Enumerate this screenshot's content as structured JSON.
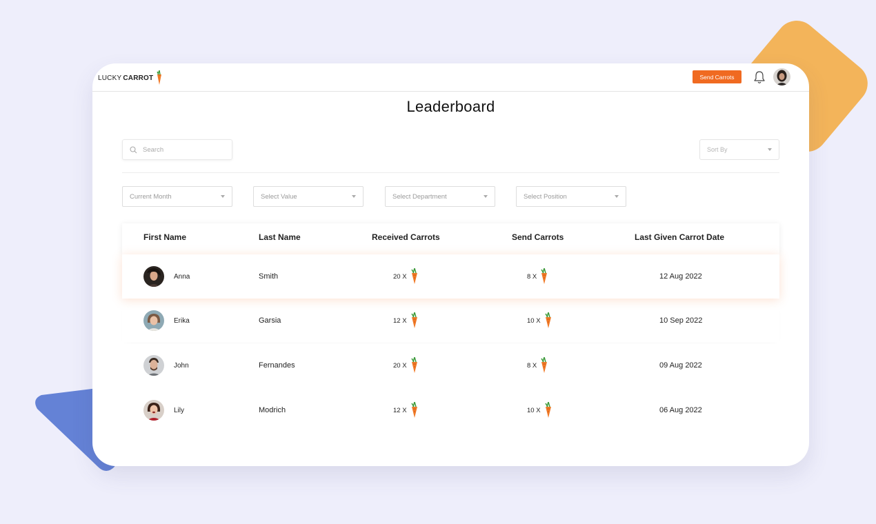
{
  "header": {
    "logo_part1": "LUCKY",
    "logo_part2": "CARROT",
    "send_button": "Send Carrots"
  },
  "page": {
    "title": "Leaderboard"
  },
  "search": {
    "placeholder": "Search"
  },
  "sort": {
    "placeholder": "Sort By"
  },
  "filters": [
    {
      "label": "Current Month"
    },
    {
      "label": "Select Value"
    },
    {
      "label": "Select Department"
    },
    {
      "label": "Select Position"
    }
  ],
  "table": {
    "columns": [
      "First Name",
      "Last Name",
      "Received Carrots",
      "Send Carrots",
      "Last Given Carrot Date"
    ],
    "rows": [
      {
        "first": "Anna",
        "last": "Smith",
        "received": "20 X",
        "sent": "8 X",
        "date": "12 Aug 2022"
      },
      {
        "first": "Erika",
        "last": "Garsia",
        "received": "12 X",
        "sent": "10 X",
        "date": "10 Sep 2022"
      },
      {
        "first": "John",
        "last": "Fernandes",
        "received": "20 X",
        "sent": "8 X",
        "date": "09 Aug 2022"
      },
      {
        "first": "Lily",
        "last": "Modrich",
        "received": "12 X",
        "sent": "10 X",
        "date": "06 Aug 2022"
      }
    ]
  },
  "icons": {
    "carrot": "carrot-icon",
    "bell": "bell-icon",
    "search": "search-icon",
    "caret": "chevron-down-icon"
  },
  "colors": {
    "accent": "#f06a21",
    "background": "#eeeefb",
    "deco_orange": "#f3b45a",
    "deco_blue": "#6482d6"
  }
}
